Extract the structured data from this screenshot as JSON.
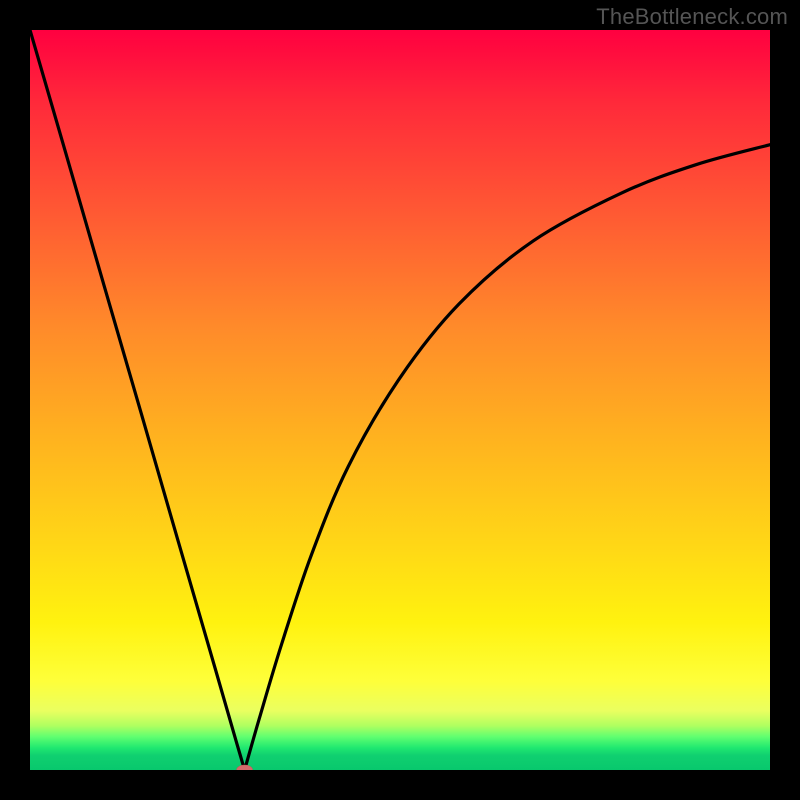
{
  "watermark": "TheBottleneck.com",
  "colors": {
    "frame": "#000000",
    "gradient_top": "#ff0040",
    "gradient_mid": "#ffd816",
    "gradient_bottom": "#08c86d",
    "curve": "#000000",
    "marker": "#d46a6a"
  },
  "chart_data": {
    "type": "line",
    "title": "",
    "xlabel": "",
    "ylabel": "",
    "x_range": [
      0,
      100
    ],
    "y_range": [
      0,
      100
    ],
    "grid": false,
    "legend_position": "none",
    "annotations": [
      {
        "type": "marker",
        "x": 29,
        "y": 0,
        "shape": "ellipse",
        "color": "#d46a6a"
      }
    ],
    "series": [
      {
        "name": "left-branch",
        "description": "near-straight descending segment from upper-left to the minimum",
        "x": [
          0.0,
          5.0,
          10.0,
          15.0,
          20.0,
          25.0,
          28.0,
          29.0
        ],
        "y": [
          100.0,
          82.8,
          65.5,
          48.3,
          31.0,
          13.8,
          3.4,
          0.0
        ]
      },
      {
        "name": "right-branch",
        "description": "concave-down rising segment from the minimum toward upper-right",
        "x": [
          29.0,
          31.0,
          34.0,
          38.0,
          43.0,
          50.0,
          58.0,
          68.0,
          80.0,
          90.0,
          100.0
        ],
        "y": [
          0.0,
          7.0,
          17.0,
          29.0,
          41.0,
          53.0,
          63.0,
          71.5,
          78.0,
          81.8,
          84.5
        ]
      }
    ],
    "background_gradient": {
      "type": "vertical-rainbow",
      "stops": [
        {
          "pos": 0.0,
          "color": "#ff0040"
        },
        {
          "pos": 0.25,
          "color": "#ff5a33"
        },
        {
          "pos": 0.55,
          "color": "#ffb21f"
        },
        {
          "pos": 0.8,
          "color": "#fff20f"
        },
        {
          "pos": 0.94,
          "color": "#b0ff60"
        },
        {
          "pos": 1.0,
          "color": "#08c86d"
        }
      ]
    }
  }
}
